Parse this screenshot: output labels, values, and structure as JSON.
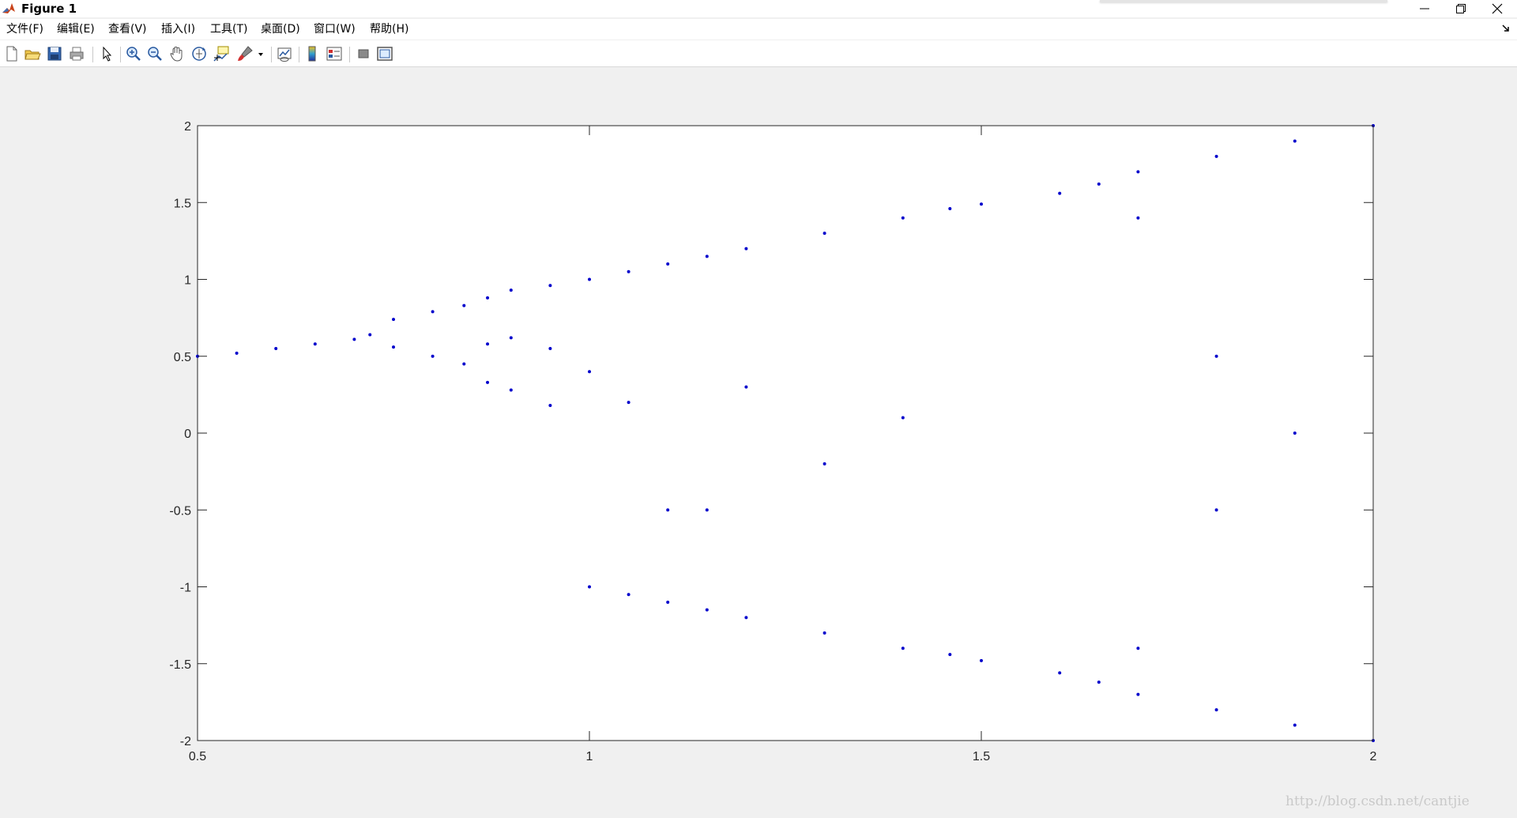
{
  "window": {
    "title": "Figure 1"
  },
  "menu": [
    {
      "label": "文件(F)",
      "id": "file"
    },
    {
      "label": "编辑(E)",
      "id": "edit"
    },
    {
      "label": "查看(V)",
      "id": "view"
    },
    {
      "label": "插入(I)",
      "id": "insert"
    },
    {
      "label": "工具(T)",
      "id": "tools"
    },
    {
      "label": "桌面(D)",
      "id": "desktop"
    },
    {
      "label": "窗口(W)",
      "id": "window"
    },
    {
      "label": "帮助(H)",
      "id": "help"
    }
  ],
  "toolbar": [
    {
      "icon": "new-figure-icon"
    },
    {
      "icon": "open-file-icon"
    },
    {
      "icon": "save-icon"
    },
    {
      "icon": "print-icon"
    },
    {
      "icon": "pointer-arrow-icon"
    },
    {
      "icon": "zoom-in-icon"
    },
    {
      "icon": "zoom-out-icon"
    },
    {
      "icon": "pan-hand-icon"
    },
    {
      "icon": "rotate-3d-icon"
    },
    {
      "icon": "data-cursor-icon"
    },
    {
      "icon": "brush-icon"
    },
    {
      "icon": "link-plot-icon"
    },
    {
      "icon": "colorbar-icon"
    },
    {
      "icon": "legend-icon"
    },
    {
      "icon": "hide-plot-tools-icon"
    },
    {
      "icon": "show-plot-tools-icon"
    }
  ],
  "chart_data": {
    "type": "scatter",
    "title": "",
    "xlabel": "",
    "ylabel": "",
    "xlim": [
      0.5,
      2
    ],
    "ylim": [
      -2,
      2
    ],
    "xticks": [
      "0.5",
      "1",
      "1.5",
      "2"
    ],
    "yticks": [
      "2",
      "1.5",
      "1",
      "0.5",
      "0",
      "-0.5",
      "-1",
      "-1.5",
      "-2"
    ],
    "xtick_values": [
      0.5,
      1,
      1.5,
      2
    ],
    "ytick_values": [
      2,
      1.5,
      1,
      0.5,
      0,
      -0.5,
      -1,
      -1.5,
      -2
    ],
    "grid": false,
    "marker_color": "#0000cc",
    "series": [
      {
        "points": [
          [
            0.5,
            0.5
          ],
          [
            0.55,
            0.52
          ],
          [
            0.6,
            0.55
          ],
          [
            0.65,
            0.58
          ],
          [
            0.7,
            0.61
          ],
          [
            0.72,
            0.64
          ],
          [
            0.75,
            0.74
          ],
          [
            0.75,
            0.56
          ],
          [
            0.8,
            0.79
          ],
          [
            0.8,
            0.5
          ],
          [
            0.84,
            0.83
          ],
          [
            0.84,
            0.45
          ],
          [
            0.87,
            0.88
          ],
          [
            0.87,
            0.58
          ],
          [
            0.87,
            0.33
          ],
          [
            0.9,
            0.93
          ],
          [
            0.9,
            0.62
          ],
          [
            0.9,
            0.28
          ],
          [
            0.95,
            0.96
          ],
          [
            0.95,
            0.55
          ],
          [
            0.95,
            0.18
          ],
          [
            1.0,
            1.0
          ],
          [
            1.0,
            0.4
          ],
          [
            1.0,
            -1.0
          ],
          [
            1.05,
            1.05
          ],
          [
            1.05,
            0.2
          ],
          [
            1.05,
            -1.05
          ],
          [
            1.1,
            1.1
          ],
          [
            1.1,
            -0.5
          ],
          [
            1.1,
            -1.1
          ],
          [
            1.15,
            1.15
          ],
          [
            1.15,
            -0.5
          ],
          [
            1.15,
            -1.15
          ],
          [
            1.2,
            1.2
          ],
          [
            1.2,
            0.3
          ],
          [
            1.2,
            -1.2
          ],
          [
            1.3,
            1.3
          ],
          [
            1.3,
            -0.2
          ],
          [
            1.3,
            -1.3
          ],
          [
            1.4,
            1.4
          ],
          [
            1.4,
            0.1
          ],
          [
            1.4,
            -1.4
          ],
          [
            1.46,
            1.46
          ],
          [
            1.46,
            -1.44
          ],
          [
            1.5,
            1.49
          ],
          [
            1.5,
            -1.48
          ],
          [
            1.6,
            1.56
          ],
          [
            1.6,
            -1.56
          ],
          [
            1.65,
            1.62
          ],
          [
            1.65,
            -1.62
          ],
          [
            1.7,
            1.7
          ],
          [
            1.7,
            1.4
          ],
          [
            1.7,
            -1.4
          ],
          [
            1.7,
            -1.7
          ],
          [
            1.8,
            1.8
          ],
          [
            1.8,
            0.5
          ],
          [
            1.8,
            -0.5
          ],
          [
            1.8,
            -1.8
          ],
          [
            1.9,
            1.9
          ],
          [
            1.9,
            0.0
          ],
          [
            1.9,
            -1.9
          ],
          [
            2.0,
            2.0
          ],
          [
            2.0,
            -2.0
          ]
        ]
      }
    ]
  },
  "watermark": "http://blog.csdn.net/cantjie"
}
